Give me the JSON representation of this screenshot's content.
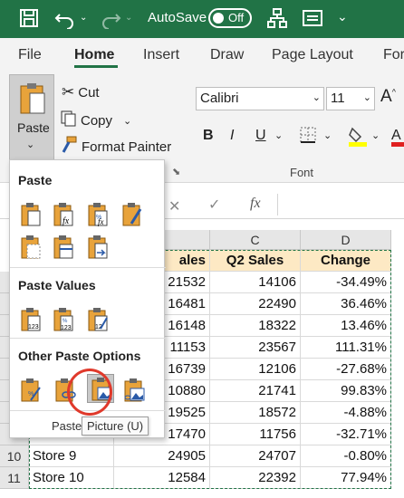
{
  "titlebar": {
    "autosave_label": "AutoSave",
    "autosave_state": "Off"
  },
  "tabs": [
    "File",
    "Home",
    "Insert",
    "Draw",
    "Page Layout",
    "For"
  ],
  "ribbon": {
    "paste_label": "Paste",
    "cut_label": "Cut",
    "copy_label": "Copy",
    "format_painter_label": "Format Painter",
    "font_name": "Calibri",
    "font_size": "11",
    "font_group_label": "Font",
    "bold": "B",
    "italic": "I",
    "underline": "U"
  },
  "formula": {
    "fx": "fx"
  },
  "sheet": {
    "columns": [
      "C",
      "D"
    ],
    "headers": {
      "b": "ales",
      "c": "Q2 Sales",
      "d": "Change"
    },
    "rows": [
      {
        "row": "",
        "a": "",
        "b": "21532",
        "c": "14106",
        "d": "-34.49%"
      },
      {
        "row": "",
        "a": "",
        "b": "16481",
        "c": "22490",
        "d": "36.46%"
      },
      {
        "row": "",
        "a": "",
        "b": "16148",
        "c": "18322",
        "d": "13.46%"
      },
      {
        "row": "",
        "a": "",
        "b": "11153",
        "c": "23567",
        "d": "111.31%"
      },
      {
        "row": "",
        "a": "",
        "b": "16739",
        "c": "12106",
        "d": "-27.68%"
      },
      {
        "row": "",
        "a": "",
        "b": "10880",
        "c": "21741",
        "d": "99.83%"
      },
      {
        "row": "",
        "a": "",
        "b": "19525",
        "c": "18572",
        "d": "-4.88%"
      },
      {
        "row": "",
        "a": "",
        "b": "17470",
        "c": "11756",
        "d": "-32.71%"
      },
      {
        "row": "10",
        "a": "Store 9",
        "b": "24905",
        "c": "24707",
        "d": "-0.80%"
      },
      {
        "row": "11",
        "a": "Store 10",
        "b": "12584",
        "c": "22392",
        "d": "77.94%"
      }
    ]
  },
  "paste_menu": {
    "section_paste": "Paste",
    "section_values": "Paste Values",
    "section_other": "Other Paste Options",
    "paste_special": "Paste",
    "tooltip": "Picture (U)"
  },
  "colors": {
    "excel_green": "#217346",
    "header_fill": "#fde9c4",
    "highlight_circle": "#e0392b"
  }
}
